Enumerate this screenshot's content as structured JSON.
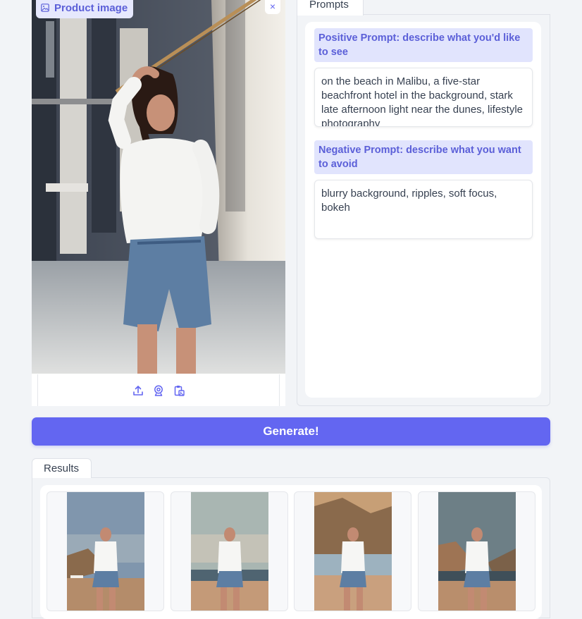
{
  "product": {
    "label": "Product image",
    "close_label": "×",
    "icons": [
      "image-icon",
      "close-icon",
      "upload-icon",
      "webcam-icon",
      "clipboard-icon"
    ]
  },
  "prompts": {
    "tab_label": "Prompts",
    "positive": {
      "label": "Positive Prompt: describe what you'd like to see",
      "value": "on the beach in Malibu, a five-star beachfront hotel in the background, stark late afternoon light near the dunes, lifestyle photography"
    },
    "negative": {
      "label": "Negative Prompt: describe what you want to avoid",
      "value": "blurry background, ripples, soft focus, bokeh"
    }
  },
  "generate": {
    "label": "Generate!"
  },
  "results": {
    "tab_label": "Results",
    "count": 4
  },
  "colors": {
    "accent": "#6366f1",
    "label_bg": "#e1e4fd",
    "label_text": "#5b5fd8",
    "page_bg": "#f2f4f7"
  }
}
